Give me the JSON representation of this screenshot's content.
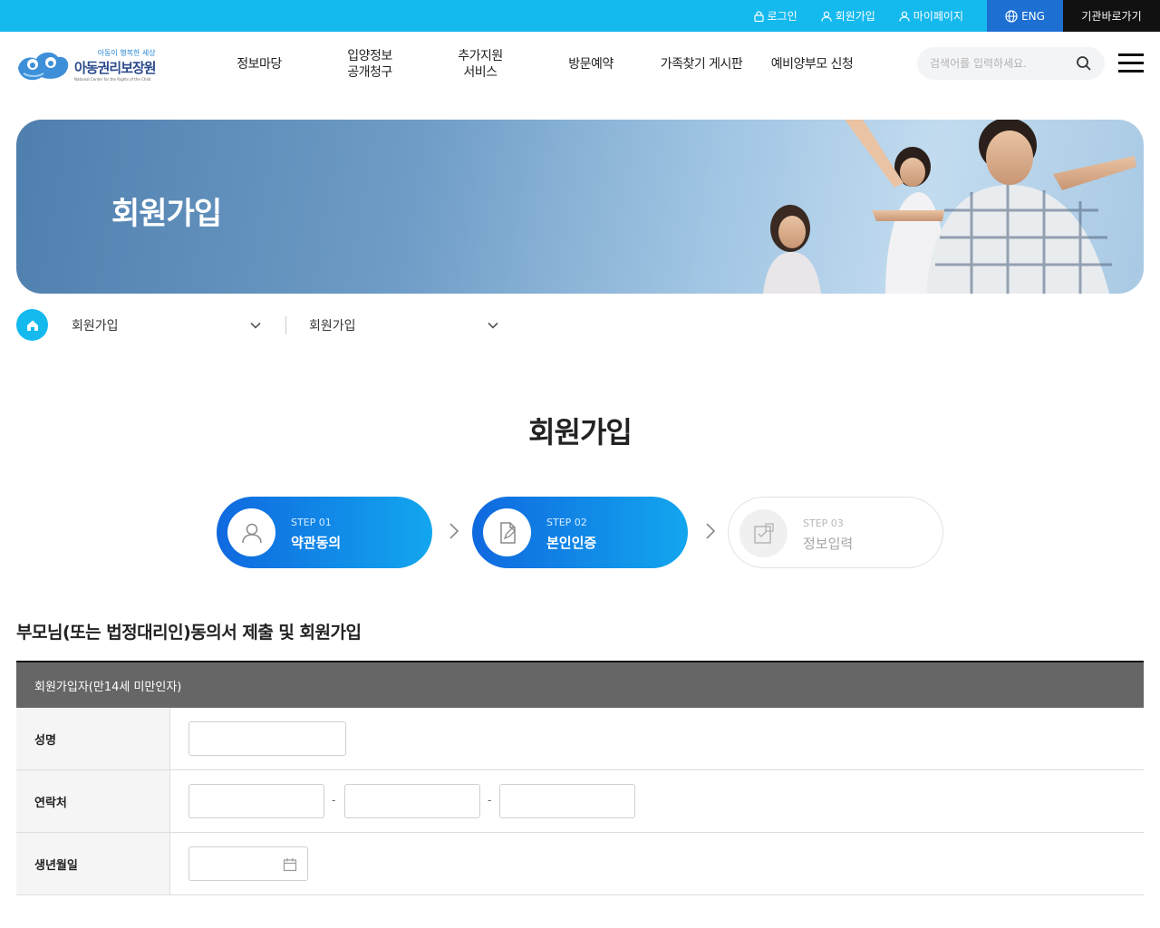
{
  "topbar": {
    "links": [
      {
        "label": "로그인",
        "icon": "lock-icon"
      },
      {
        "label": "회원가입",
        "icon": "user-icon"
      },
      {
        "label": "마이페이지",
        "icon": "user-icon"
      }
    ],
    "eng_label": "ENG",
    "institution_label": "기관바로가기"
  },
  "logo": {
    "tagline": "아동이 행복한 세상",
    "name": "아동권리보장원",
    "english": "National Center for the Rights of the Child"
  },
  "gnb": [
    "정보마당",
    "입양정보\n공개청구",
    "추가지원\n서비스",
    "방문예약",
    "가족찾기 게시판",
    "예비양부모 신청"
  ],
  "search": {
    "placeholder": "검색어를 입력하세요.",
    "value": ""
  },
  "banner": {
    "title": "회원가입"
  },
  "breadcrumb": {
    "level1": "회원가입",
    "level2": "회원가입"
  },
  "page_title": "회원가입",
  "steps": [
    {
      "num": "STEP 01",
      "name": "약관동의",
      "state": "done"
    },
    {
      "num": "STEP 02",
      "name": "본인인증",
      "state": "current"
    },
    {
      "num": "STEP 03",
      "name": "정보입력",
      "state": "pending"
    }
  ],
  "section_title": "부모님(또는 법정대리인)동의서 제출 및 회원가입",
  "form": {
    "header": "회원가입자(만14세 미만인자)",
    "name_label": "성명",
    "phone_label": "연락처",
    "phone_separator": "-",
    "birth_label": "생년월일"
  },
  "colors": {
    "topbar": "#14b9ee",
    "eng_button": "#1e6fd2",
    "institution_button": "#111111",
    "step_gradient_start": "#1069df",
    "step_gradient_end": "#12a6ee",
    "form_header": "#666666"
  }
}
